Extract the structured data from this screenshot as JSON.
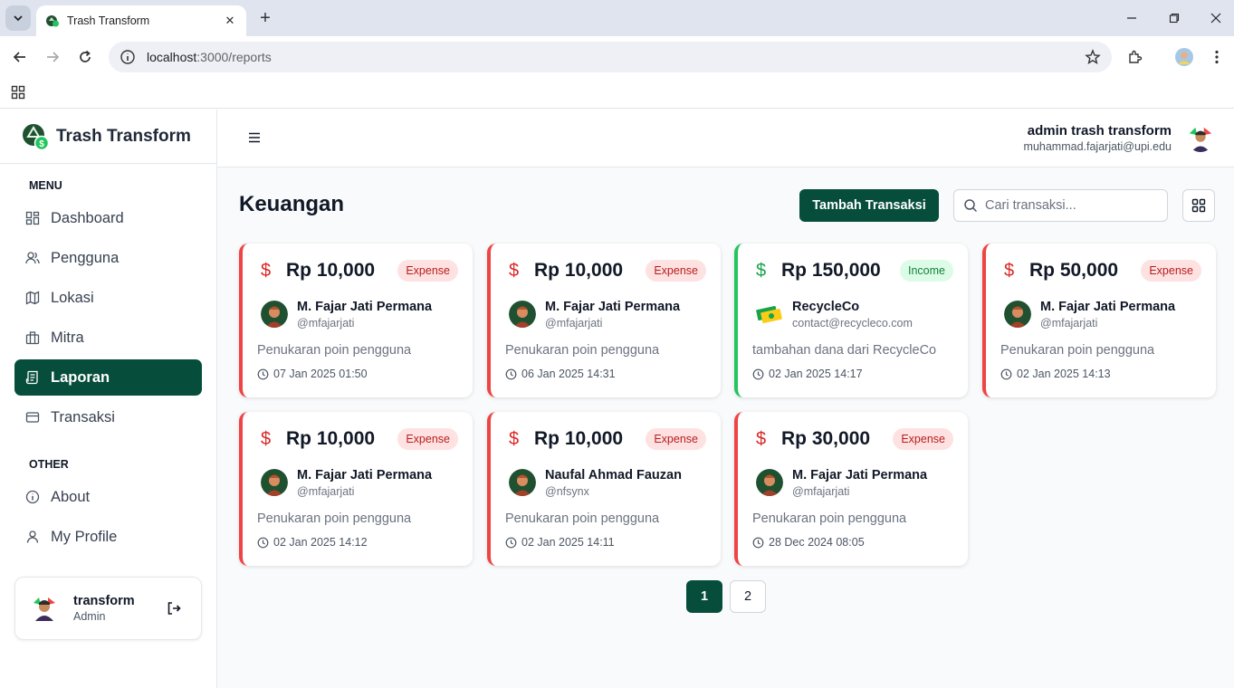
{
  "browser": {
    "tab_title": "Trash Transform",
    "url_host": "localhost",
    "url_path": ":3000/reports"
  },
  "sidebar": {
    "brand": "Trash Transform",
    "menu_label": "MENU",
    "items": [
      {
        "label": "Dashboard",
        "icon": "dashboard-icon"
      },
      {
        "label": "Pengguna",
        "icon": "users-icon"
      },
      {
        "label": "Lokasi",
        "icon": "map-icon"
      },
      {
        "label": "Mitra",
        "icon": "building-icon"
      },
      {
        "label": "Laporan",
        "icon": "report-icon",
        "active": true
      },
      {
        "label": "Transaksi",
        "icon": "card-icon"
      }
    ],
    "other_label": "OTHER",
    "other_items": [
      {
        "label": "About",
        "icon": "info-icon"
      },
      {
        "label": "My Profile",
        "icon": "user-icon"
      }
    ],
    "profile": {
      "name": "transform",
      "role": "Admin"
    }
  },
  "header": {
    "admin_name": "admin trash transform",
    "admin_email": "muhammad.fajarjati@upi.edu"
  },
  "main": {
    "title": "Keuangan",
    "add_button": "Tambah Transaksi",
    "search_placeholder": "Cari transaksi..."
  },
  "cards": [
    {
      "amount": "Rp 10,000",
      "type": "Expense",
      "name": "M. Fajar Jati Permana",
      "handle": "@mfajarjati",
      "description": "Penukaran poin pengguna",
      "date": "07 Jan 2025 01:50"
    },
    {
      "amount": "Rp 10,000",
      "type": "Expense",
      "name": "M. Fajar Jati Permana",
      "handle": "@mfajarjati",
      "description": "Penukaran poin pengguna",
      "date": "06 Jan 2025 14:31"
    },
    {
      "amount": "Rp 150,000",
      "type": "Income",
      "name": "RecycleCo",
      "handle": "contact@recycleco.com",
      "description": "tambahan dana dari RecycleCo",
      "date": "02 Jan 2025 14:17"
    },
    {
      "amount": "Rp 50,000",
      "type": "Expense",
      "name": "M. Fajar Jati Permana",
      "handle": "@mfajarjati",
      "description": "Penukaran poin pengguna",
      "date": "02 Jan 2025 14:13"
    },
    {
      "amount": "Rp 10,000",
      "type": "Expense",
      "name": "M. Fajar Jati Permana",
      "handle": "@mfajarjati",
      "description": "Penukaran poin pengguna",
      "date": "02 Jan 2025 14:12"
    },
    {
      "amount": "Rp 10,000",
      "type": "Expense",
      "name": "Naufal Ahmad Fauzan",
      "handle": "@nfsynx",
      "description": "Penukaran poin pengguna",
      "date": "02 Jan 2025 14:11"
    },
    {
      "amount": "Rp 30,000",
      "type": "Expense",
      "name": "M. Fajar Jati Permana",
      "handle": "@mfajarjati",
      "description": "Penukaran poin pengguna",
      "date": "28 Dec 2024 08:05"
    }
  ],
  "pagination": {
    "pages": [
      "1",
      "2"
    ],
    "current": "1"
  },
  "colors": {
    "primary": "#064e3b",
    "expense": "#ef4444",
    "income": "#22c55e"
  }
}
